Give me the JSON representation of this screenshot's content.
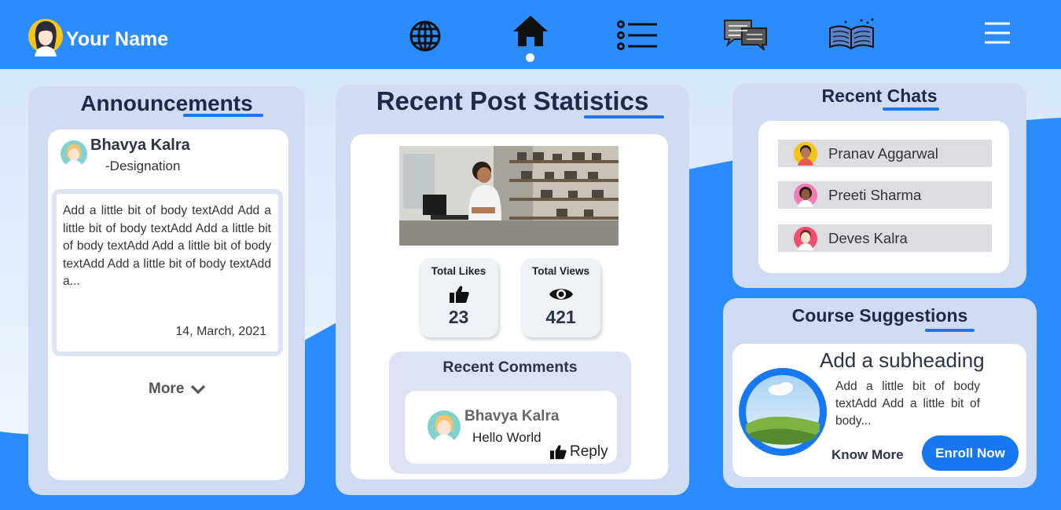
{
  "header": {
    "user_name": "Your Name",
    "nav_icons": [
      "globe-icon",
      "home-icon",
      "list-icon",
      "chat-icon",
      "book-icon",
      "menu-icon"
    ],
    "active_nav": "home-icon"
  },
  "colors": {
    "primary": "#2b8cff",
    "accent": "#1877f2",
    "card_bg": "#cfdcf3",
    "heading": "#1d2a4a"
  },
  "announcements": {
    "title": "Announcements",
    "author": "Bhavya Kalra",
    "designation": "-Designation",
    "body": "Add a little bit of body textAdd Add a little bit of body textAdd Add a little bit of body textAdd Add a little bit of body textAdd Add a little bit of body textAdd a...",
    "date": "14, March, 2021",
    "more_label": "More"
  },
  "post_stats": {
    "title": "Recent Post Statistics",
    "likes_label": "Total Likes",
    "likes": "23",
    "views_label": "Total Views",
    "views": "421",
    "comments_title": "Recent Comments",
    "comment": {
      "author": "Bhavya Kalra",
      "text": "Hello World",
      "reply_label": "Reply"
    }
  },
  "chats": {
    "title": "Recent Chats",
    "items": [
      {
        "name": "Pranav Aggarwal"
      },
      {
        "name": "Preeti Sharma"
      },
      {
        "name": "Deves Kalra"
      }
    ]
  },
  "course": {
    "title": "Course Suggestions",
    "subheading": "Add a subheading",
    "body": "Add a little bit of body textAdd Add a little bit of body...",
    "know_more_label": "Know More",
    "enroll_label": "Enroll Now"
  }
}
